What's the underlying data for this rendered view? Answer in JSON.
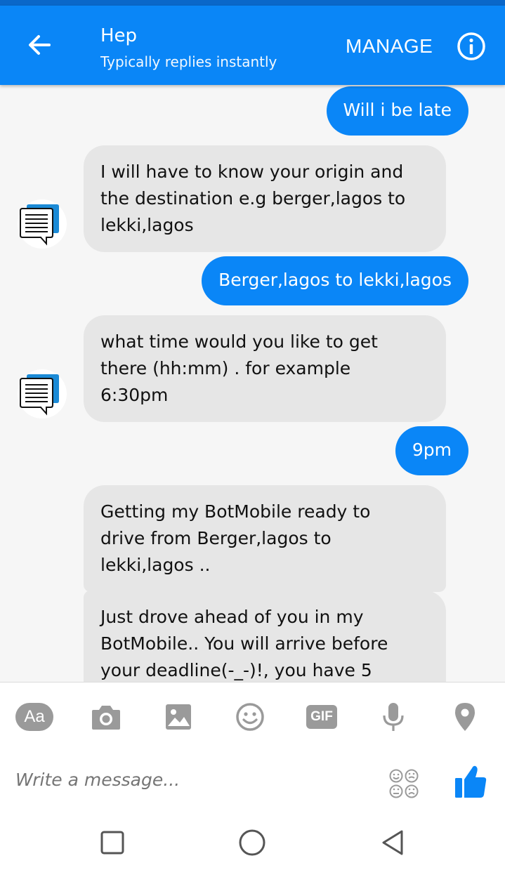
{
  "header": {
    "title": "Hep",
    "subtitle": "Typically replies instantly",
    "manage_label": "MANAGE"
  },
  "messages": [
    {
      "from": "user",
      "text": "Will i be late"
    },
    {
      "from": "bot",
      "lines": [
        "I will have to know your origin and",
        "the destination e.g berger,lagos to",
        "lekki,lagos"
      ]
    },
    {
      "from": "user",
      "text": "Berger,lagos to lekki,lagos"
    },
    {
      "from": "bot",
      "lines": [
        "what time would you like to get",
        "there (hh:mm) . for example",
        "6:30pm"
      ]
    },
    {
      "from": "user",
      "text": "9pm"
    },
    {
      "from": "bot",
      "lines": [
        "Getting my BotMobile ready to",
        "drive from Berger,lagos to",
        "lekki,lagos .."
      ]
    },
    {
      "from": "bot",
      "lines": [
        "Just drove ahead of you in my",
        "BotMobile.. You will arrive before",
        "your deadline(-_-)!, you have 5"
      ]
    }
  ],
  "composer": {
    "placeholder": "Write a message...",
    "aa_label": "Aa",
    "gif_label": "GIF",
    "tools": [
      "text-format-icon",
      "camera-icon",
      "image-icon",
      "emoji-icon",
      "gif-icon",
      "microphone-icon",
      "location-pin-icon"
    ]
  },
  "colors": {
    "brand": "#0a86f7",
    "incoming_bubble": "#e6e6e6",
    "icon_gray": "#9a9a9a"
  }
}
